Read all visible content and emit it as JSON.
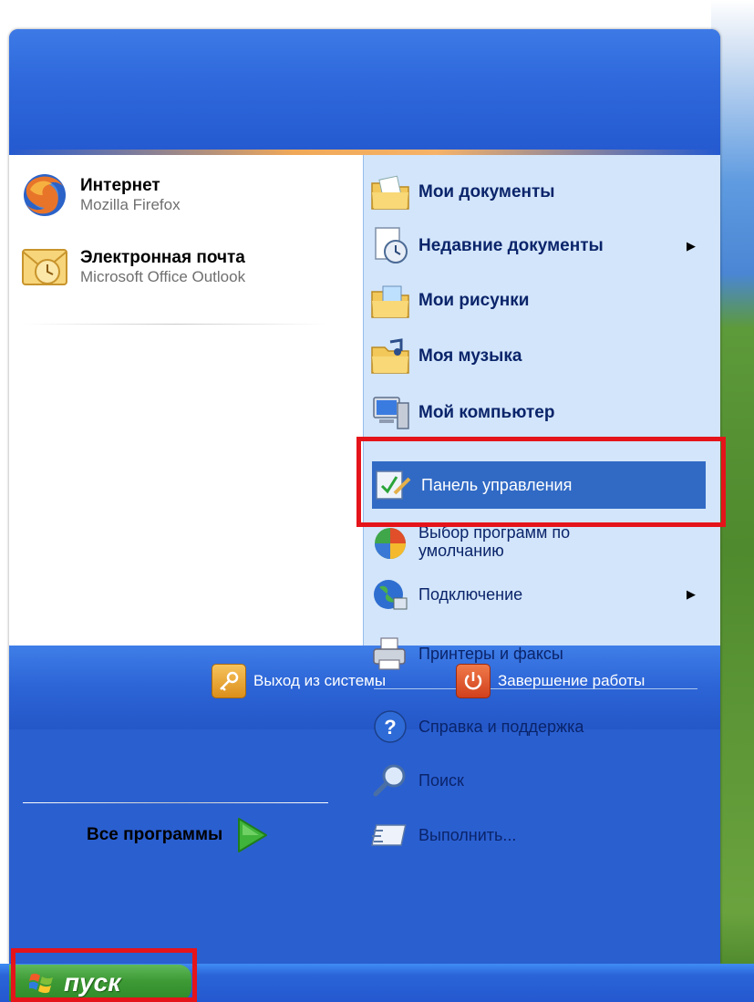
{
  "pinned": [
    {
      "title": "Интернет",
      "subtitle": "Mozilla Firefox",
      "icon": "firefox-icon"
    },
    {
      "title": "Электронная почта",
      "subtitle": "Microsoft Office Outlook",
      "icon": "outlook-icon"
    }
  ],
  "all_programs": {
    "label": "Все программы",
    "icon": "green-arrow-icon"
  },
  "places": [
    {
      "label": "Мои документы",
      "icon": "my-documents-icon",
      "bold": true,
      "submenu": false
    },
    {
      "label": "Недавние документы",
      "icon": "recent-documents-icon",
      "bold": true,
      "submenu": true,
      "arrow": "▶"
    },
    {
      "label": "Мои рисунки",
      "icon": "my-pictures-icon",
      "bold": true,
      "submenu": false
    },
    {
      "label": "Моя музыка",
      "icon": "my-music-icon",
      "bold": true,
      "submenu": false
    },
    {
      "label": "Мой компьютер",
      "icon": "my-computer-icon",
      "bold": true,
      "submenu": false
    },
    {
      "label": "Панель управления",
      "icon": "control-panel-icon",
      "bold": false,
      "submenu": false,
      "selected": true
    },
    {
      "label": "Выбор программ по умолчанию",
      "icon": "default-programs-icon",
      "bold": false,
      "submenu": false
    },
    {
      "label": "Подключение",
      "icon": "connect-icon",
      "bold": false,
      "submenu": true,
      "arrow": "▶"
    },
    {
      "label": "Принтеры и факсы",
      "icon": "printers-icon",
      "bold": false,
      "submenu": false
    },
    {
      "label": "Справка и поддержка",
      "icon": "help-icon",
      "bold": false,
      "submenu": false
    },
    {
      "label": "Поиск",
      "icon": "search-icon",
      "bold": false,
      "submenu": false
    },
    {
      "label": "Выполнить...",
      "icon": "run-icon",
      "bold": false,
      "submenu": false
    }
  ],
  "footer": {
    "logoff": {
      "label": "Выход из системы",
      "icon": "key-icon"
    },
    "shutdown": {
      "label": "Завершение работы",
      "icon": "power-icon"
    }
  },
  "taskbar": {
    "start_label": "пуск",
    "start_icon": "windows-logo-icon"
  },
  "colors": {
    "highlight_box": "#e5141a",
    "selected_item": "#316ac5",
    "right_panel": "#d3e5fa"
  }
}
